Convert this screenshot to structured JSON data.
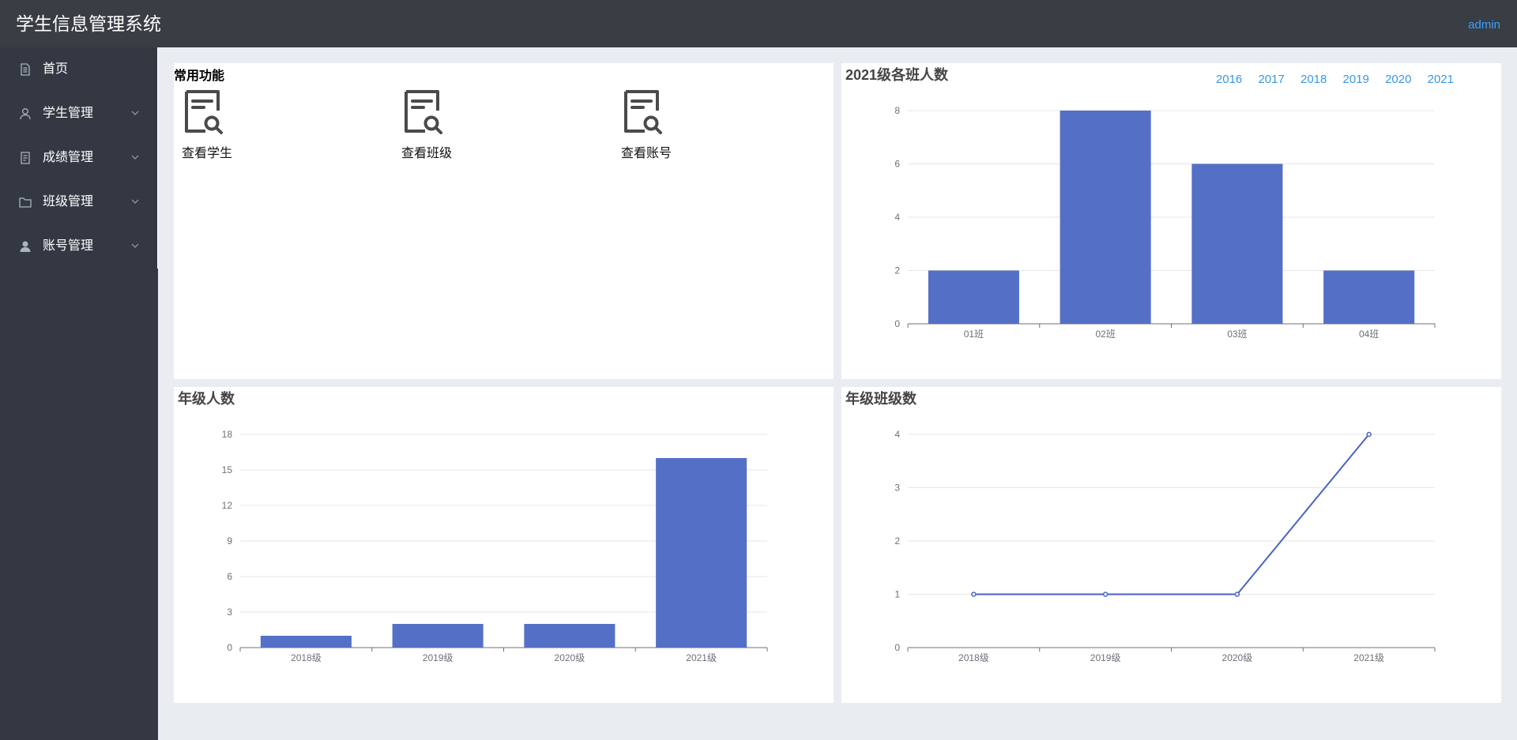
{
  "header": {
    "app_title": "学生信息管理系统",
    "user": "admin"
  },
  "sidebar": {
    "items": [
      {
        "label": "首页",
        "icon": "document-icon",
        "has_submenu": false
      },
      {
        "label": "学生管理",
        "icon": "user-icon",
        "has_submenu": true
      },
      {
        "label": "成绩管理",
        "icon": "document-icon",
        "has_submenu": true
      },
      {
        "label": "班级管理",
        "icon": "folder-icon",
        "has_submenu": true
      },
      {
        "label": "账号管理",
        "icon": "account-icon",
        "has_submenu": true
      }
    ]
  },
  "common": {
    "title": "常用功能",
    "items": [
      {
        "label": "查看学生",
        "icon": "document-search-icon"
      },
      {
        "label": "查看班级",
        "icon": "document-search-icon"
      },
      {
        "label": "查看账号",
        "icon": "document-search-icon"
      }
    ]
  },
  "colors": {
    "bar": "#5470c6",
    "line": "#4763c4",
    "link": "#3a96e8",
    "header_bg": "#393d44",
    "sidebar_bg": "#333843"
  },
  "year_tabs": [
    "2016",
    "2017",
    "2018",
    "2019",
    "2020",
    "2021"
  ],
  "chart_data": [
    {
      "id": "class_counts",
      "type": "bar",
      "title": "2021级各班人数",
      "categories": [
        "01班",
        "02班",
        "03班",
        "04班"
      ],
      "values": [
        2,
        8,
        6,
        2
      ],
      "ylim": [
        0,
        8
      ],
      "yticks": [
        0,
        2,
        4,
        6,
        8
      ],
      "grid": true
    },
    {
      "id": "grade_counts",
      "type": "bar",
      "title": "年级人数",
      "categories": [
        "2018级",
        "2019级",
        "2020级",
        "2021级"
      ],
      "values": [
        1,
        2,
        2,
        16
      ],
      "ylim": [
        0,
        18
      ],
      "yticks": [
        0,
        3,
        6,
        9,
        12,
        15,
        18
      ],
      "grid": true
    },
    {
      "id": "grade_class_counts",
      "type": "line",
      "title": "年级班级数",
      "categories": [
        "2018级",
        "2019级",
        "2020级",
        "2021级"
      ],
      "values": [
        1,
        1,
        1,
        4
      ],
      "ylim": [
        0,
        4
      ],
      "yticks": [
        0,
        1,
        2,
        3,
        4
      ],
      "grid": true
    }
  ]
}
